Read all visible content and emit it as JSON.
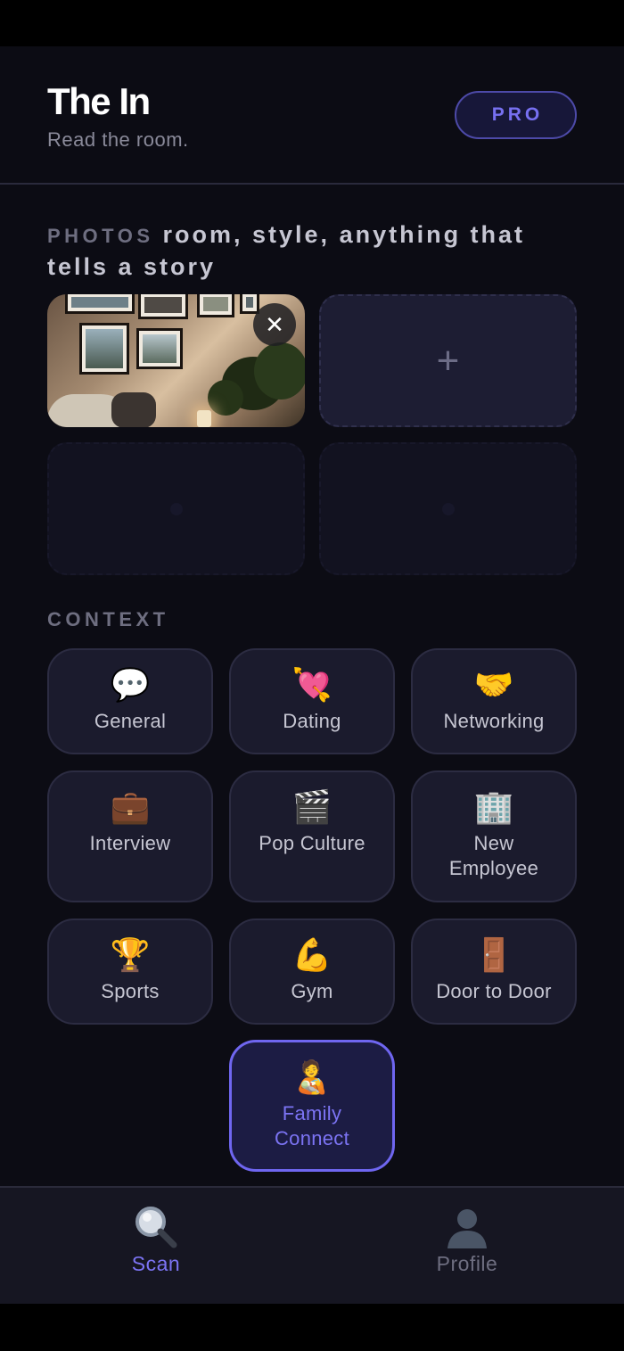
{
  "header": {
    "title": "The In",
    "subtitle": "Read the room.",
    "pro_label": "PRO"
  },
  "photos": {
    "label": "PHOTOS",
    "hint": "room, style, anything that tells a story",
    "add_symbol": "+",
    "remove_symbol": "✕"
  },
  "context": {
    "label": "CONTEXT",
    "options": [
      {
        "emoji": "💬",
        "label": "General"
      },
      {
        "emoji": "💘",
        "label": "Dating"
      },
      {
        "emoji": "🤝",
        "label": "Networking"
      },
      {
        "emoji": "💼",
        "label": "Interview"
      },
      {
        "emoji": "🎬",
        "label": "Pop Culture"
      },
      {
        "emoji": "🏢",
        "label": "New Employee"
      },
      {
        "emoji": "🏆",
        "label": "Sports"
      },
      {
        "emoji": "💪",
        "label": "Gym"
      },
      {
        "emoji": "🚪",
        "label": "Door to Door"
      },
      {
        "emoji": "🧑‍🍼",
        "label": "Family Connect"
      }
    ],
    "selected": "Family Connect"
  },
  "nav": {
    "items": [
      {
        "label": "Scan",
        "icon": "magnifier-icon",
        "active": true
      },
      {
        "label": "Profile",
        "icon": "person-silhouette-icon",
        "active": false
      }
    ]
  },
  "colors": {
    "background": "#0c0c14",
    "accent": "#6f66f0",
    "card": "#1b1b2d",
    "nav_inactive": "#6e6e80"
  }
}
